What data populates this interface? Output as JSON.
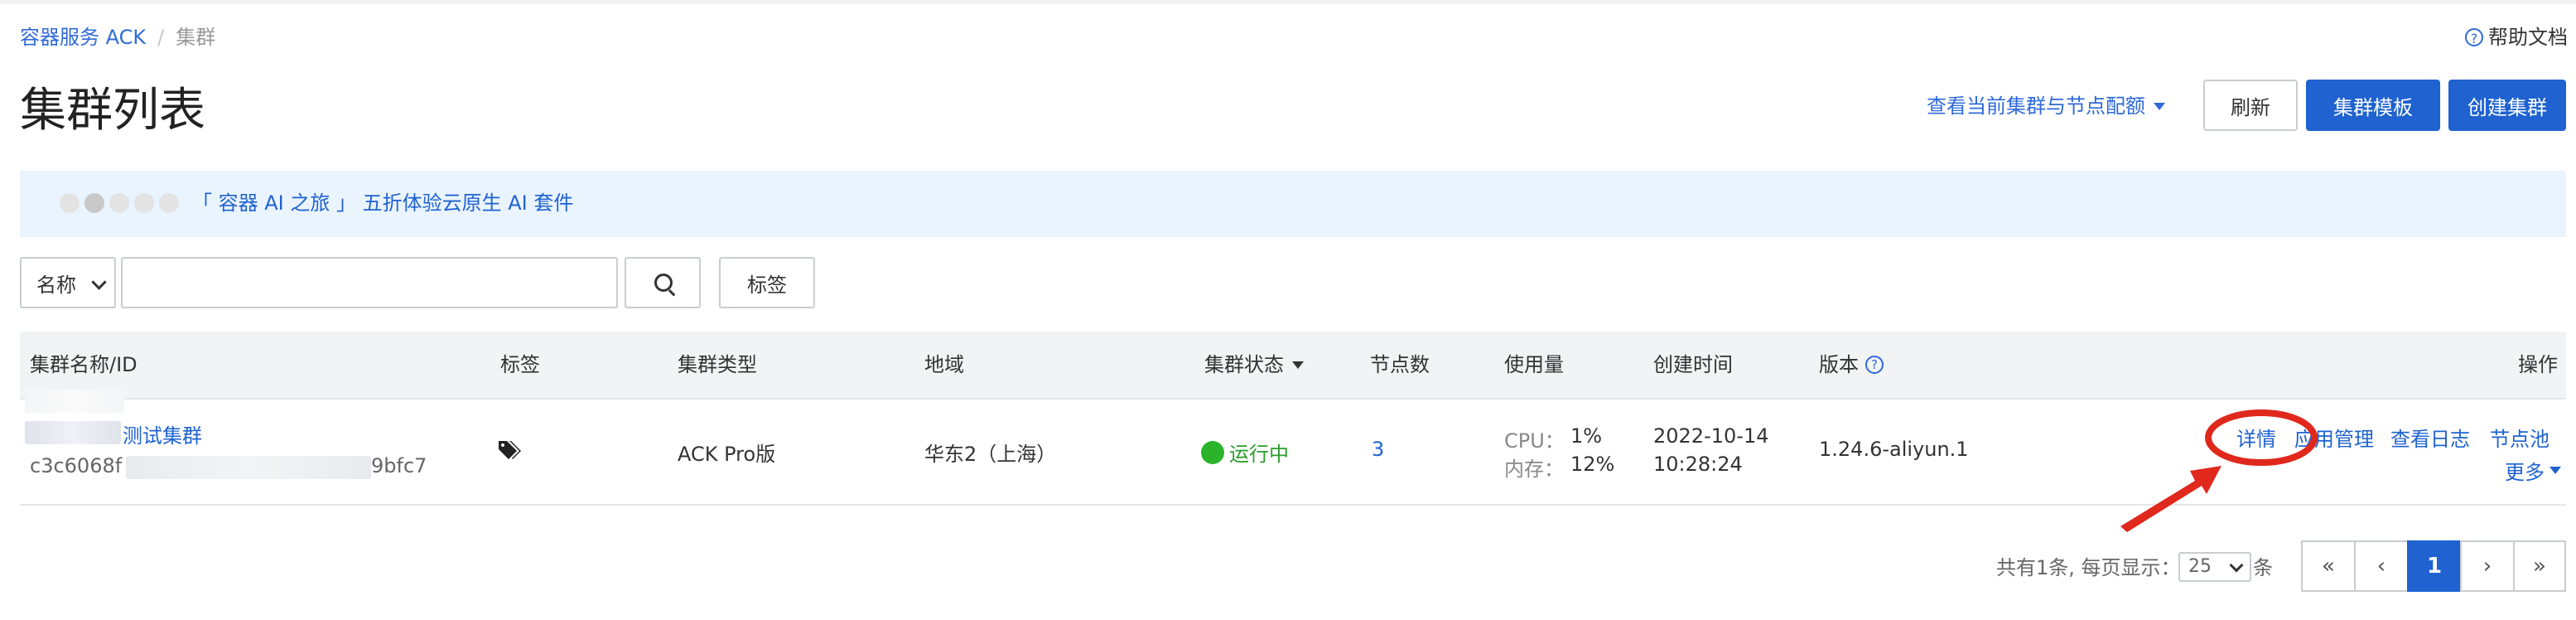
{
  "breadcrumb": {
    "root": "容器服务 ACK",
    "separator": "/",
    "current": "集群"
  },
  "help": {
    "label": "帮助文档"
  },
  "page_title": "集群列表",
  "toolbar": {
    "quota_link": "查看当前集群与节点配额",
    "refresh": "刷新",
    "template": "集群模板",
    "create": "创建集群"
  },
  "banner": {
    "text": "「 容器 AI 之旅 」 五折体验云原生 AI 套件"
  },
  "search": {
    "field_select": "名称",
    "input_value": "",
    "tag_button": "标签"
  },
  "table": {
    "headers": {
      "name": "集群名称/ID",
      "tags": "标签",
      "type": "集群类型",
      "region": "地域",
      "status": "集群状态",
      "nodes": "节点数",
      "usage": "使用量",
      "created": "创建时间",
      "version": "版本",
      "actions": "操作"
    },
    "rows": [
      {
        "name": "测试集群",
        "id_prefix": "c3c6068f",
        "id_suffix": "9bfc7",
        "type": "ACK Pro版",
        "region": "华东2（上海）",
        "status": "运行中",
        "nodes": "3",
        "cpu_label": "CPU：",
        "cpu_value": "1%",
        "mem_label": "内存：",
        "mem_value": "12%",
        "created_date": "2022-10-14",
        "created_time": "10:28:24",
        "version": "1.24.6-aliyun.1",
        "actions": {
          "detail": "详情",
          "apps": "应用管理",
          "logs": "查看日志",
          "nodepool": "节点池",
          "more": "更多"
        }
      }
    ]
  },
  "pagination": {
    "summary": "共有1条, 每页显示：",
    "page_size": "25",
    "unit": "条",
    "first": "«",
    "prev": "‹",
    "current": "1",
    "next": "›",
    "last": "»"
  },
  "colors": {
    "accent": "#1f62d0",
    "status_ok": "#2bb32b",
    "annotation": "#e0281c"
  },
  "icons": [
    "help-icon",
    "chevron-down-icon",
    "search-icon",
    "tag-icon",
    "status-running-icon",
    "info-icon",
    "annotation-arrow-icon"
  ]
}
